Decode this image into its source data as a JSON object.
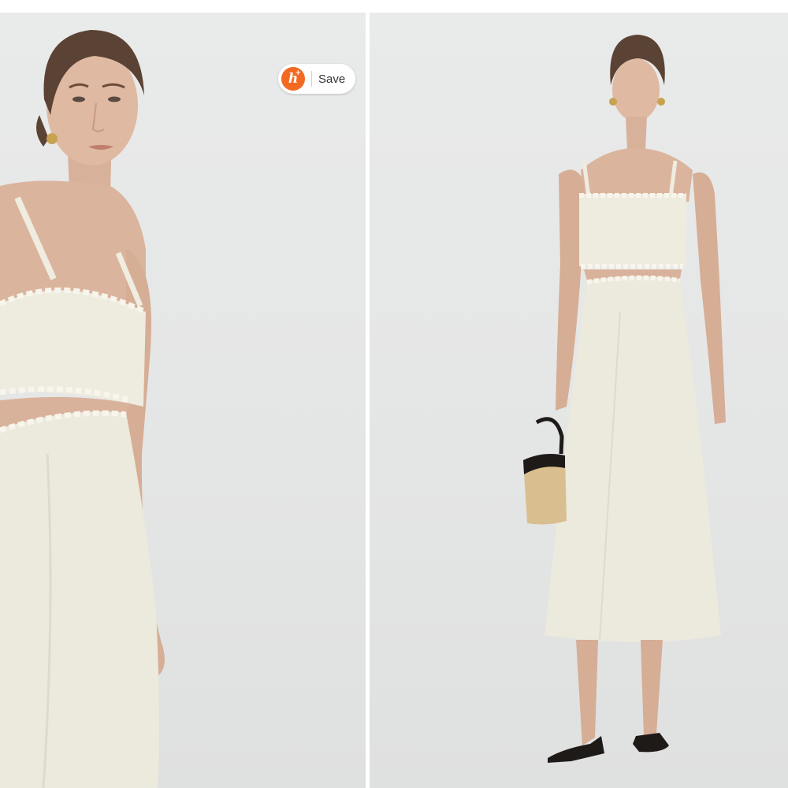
{
  "save_button": {
    "label": "Save",
    "brand_icon": "h-plus-icon",
    "brand_color": "#f26a21"
  },
  "images": {
    "left": "model-closeup-photo",
    "right": "model-full-length-photo"
  },
  "colors": {
    "background": "#e6e7e7",
    "dress": "#eeebdf",
    "skin": "#d9b29b",
    "hair": "#5a4234"
  }
}
